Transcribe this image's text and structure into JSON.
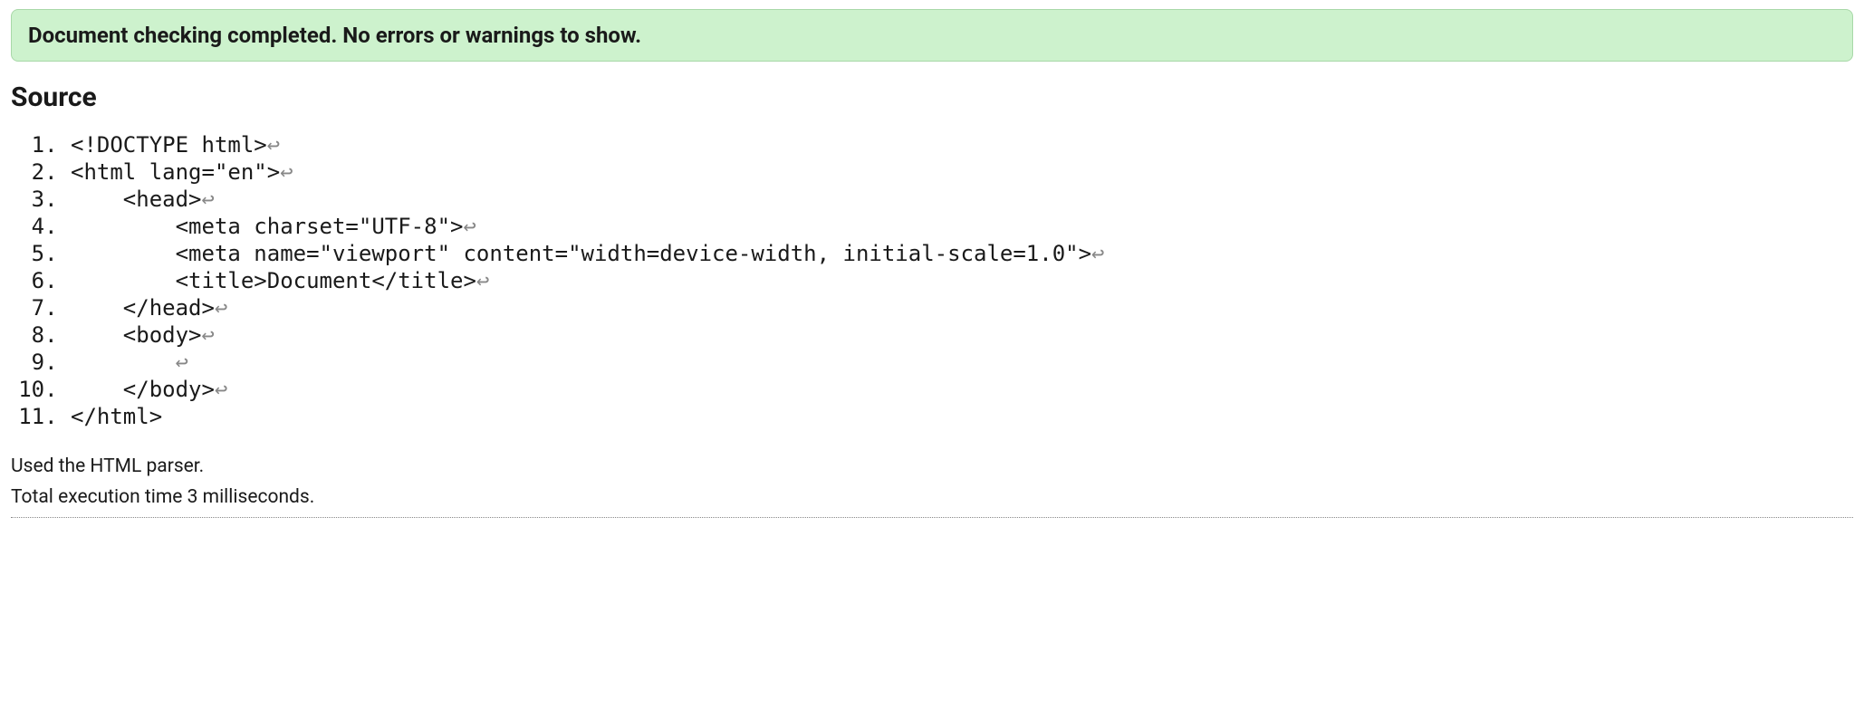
{
  "success_message": "Document checking completed. No errors or warnings to show.",
  "source_heading": "Source",
  "newline_glyph": "↩",
  "source_lines": [
    {
      "indent": "",
      "text": "<!DOCTYPE html>",
      "newline": true
    },
    {
      "indent": "",
      "text": "<html lang=\"en\">",
      "newline": true
    },
    {
      "indent": "    ",
      "text": "<head>",
      "newline": true
    },
    {
      "indent": "        ",
      "text": "<meta charset=\"UTF-8\">",
      "newline": true
    },
    {
      "indent": "        ",
      "text": "<meta name=\"viewport\" content=\"width=device-width, initial-scale=1.0\">",
      "newline": true
    },
    {
      "indent": "        ",
      "text": "<title>Document</title>",
      "newline": true
    },
    {
      "indent": "    ",
      "text": "</head>",
      "newline": true
    },
    {
      "indent": "    ",
      "text": "<body>",
      "newline": true
    },
    {
      "indent": "        ",
      "text": "",
      "newline": true
    },
    {
      "indent": "    ",
      "text": "</body>",
      "newline": true
    },
    {
      "indent": "",
      "text": "</html>",
      "newline": false
    }
  ],
  "parser_info": "Used the HTML parser.",
  "execution_time": "Total execution time 3 milliseconds."
}
